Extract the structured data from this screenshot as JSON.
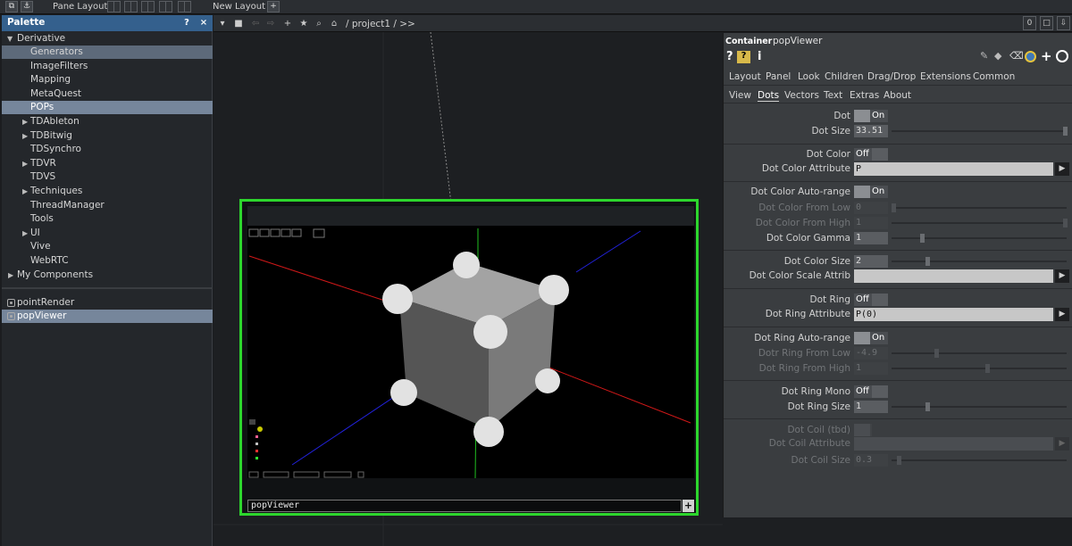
{
  "top_toolbar": {
    "pane_layout_label": "Pane Layout",
    "new_layout_label": "New Layout",
    "add_label": "+"
  },
  "palette": {
    "title": "Palette",
    "help_label": "?",
    "close_label": "×",
    "root": "Derivative",
    "items": [
      {
        "label": "Generators",
        "selected": true,
        "expandable": false
      },
      {
        "label": "ImageFilters",
        "selected": false,
        "expandable": false
      },
      {
        "label": "Mapping",
        "selected": false,
        "expandable": false
      },
      {
        "label": "MetaQuest",
        "selected": false,
        "expandable": false
      },
      {
        "label": "POPs",
        "selected": true,
        "expandable": false
      },
      {
        "label": "TDAbleton",
        "selected": false,
        "expandable": true
      },
      {
        "label": "TDBitwig",
        "selected": false,
        "expandable": true
      },
      {
        "label": "TDSynchro",
        "selected": false,
        "expandable": false
      },
      {
        "label": "TDVR",
        "selected": false,
        "expandable": true
      },
      {
        "label": "TDVS",
        "selected": false,
        "expandable": false
      },
      {
        "label": "Techniques",
        "selected": false,
        "expandable": true
      },
      {
        "label": "ThreadManager",
        "selected": false,
        "expandable": false
      },
      {
        "label": "Tools",
        "selected": false,
        "expandable": false
      },
      {
        "label": "UI",
        "selected": false,
        "expandable": true
      },
      {
        "label": "Vive",
        "selected": false,
        "expandable": false
      },
      {
        "label": "WebRTC",
        "selected": false,
        "expandable": false
      }
    ],
    "my_components": "My Components",
    "local": [
      {
        "label": "pointRender",
        "selected": false
      },
      {
        "label": "popViewer",
        "selected": true
      }
    ]
  },
  "network": {
    "path": "/ project1 / >>",
    "right_count": "0"
  },
  "viewer": {
    "name": "popViewer",
    "plus_label": "+"
  },
  "params": {
    "op_type": "Container",
    "op_name": "popViewer",
    "pages": [
      "Layout",
      "Panel",
      "Look",
      "Children",
      "Drag/Drop",
      "Extensions",
      "Common"
    ],
    "subpages": [
      "View",
      "Dots",
      "Vectors",
      "Text",
      "Extras",
      "About"
    ],
    "active_subpage": "Dots",
    "rows": {
      "dot": {
        "label": "Dot",
        "value": "On"
      },
      "dot_size": {
        "label": "Dot Size",
        "value": "33.51"
      },
      "dot_color": {
        "label": "Dot Color",
        "value": "Off"
      },
      "dot_color_attr": {
        "label": "Dot Color Attribute",
        "value": "P"
      },
      "dot_color_autorange": {
        "label": "Dot Color Auto-range",
        "value": "On"
      },
      "dot_color_from_low": {
        "label": "Dot Color From Low",
        "value": "0"
      },
      "dot_color_from_high": {
        "label": "Dot Color From High",
        "value": "1"
      },
      "dot_color_gamma": {
        "label": "Dot Color Gamma",
        "value": "1"
      },
      "dot_color_size": {
        "label": "Dot Color Size",
        "value": "2"
      },
      "dot_color_scale_attr": {
        "label": "Dot Color Scale Attrib",
        "value": ""
      },
      "dot_ring": {
        "label": "Dot Ring",
        "value": "Off"
      },
      "dot_ring_attr": {
        "label": "Dot Ring Attribute",
        "value": "P(0)"
      },
      "dot_ring_autorange": {
        "label": "Dot Ring Auto-range",
        "value": "On"
      },
      "dot_ring_from_low": {
        "label": "Dotr Ring From Low",
        "value": "-4.9"
      },
      "dot_ring_from_high": {
        "label": "Dot Ring From High",
        "value": "1"
      },
      "dot_ring_mono": {
        "label": "Dot Ring Mono",
        "value": "Off"
      },
      "dot_ring_size": {
        "label": "Dot Ring Size",
        "value": "1"
      },
      "dot_coil": {
        "label": "Dot Coil (tbd)",
        "value": ""
      },
      "dot_coil_attr": {
        "label": "Dot Coil Attribute",
        "value": ""
      },
      "dot_coil_size": {
        "label": "Dot Coil Size",
        "value": "0.3"
      }
    }
  },
  "colors": {
    "palette_header": "#34608d",
    "viewer_border": "#2dd62d",
    "axis_x": "#d01818",
    "axis_y": "#20c020",
    "axis_z": "#2222dd"
  }
}
